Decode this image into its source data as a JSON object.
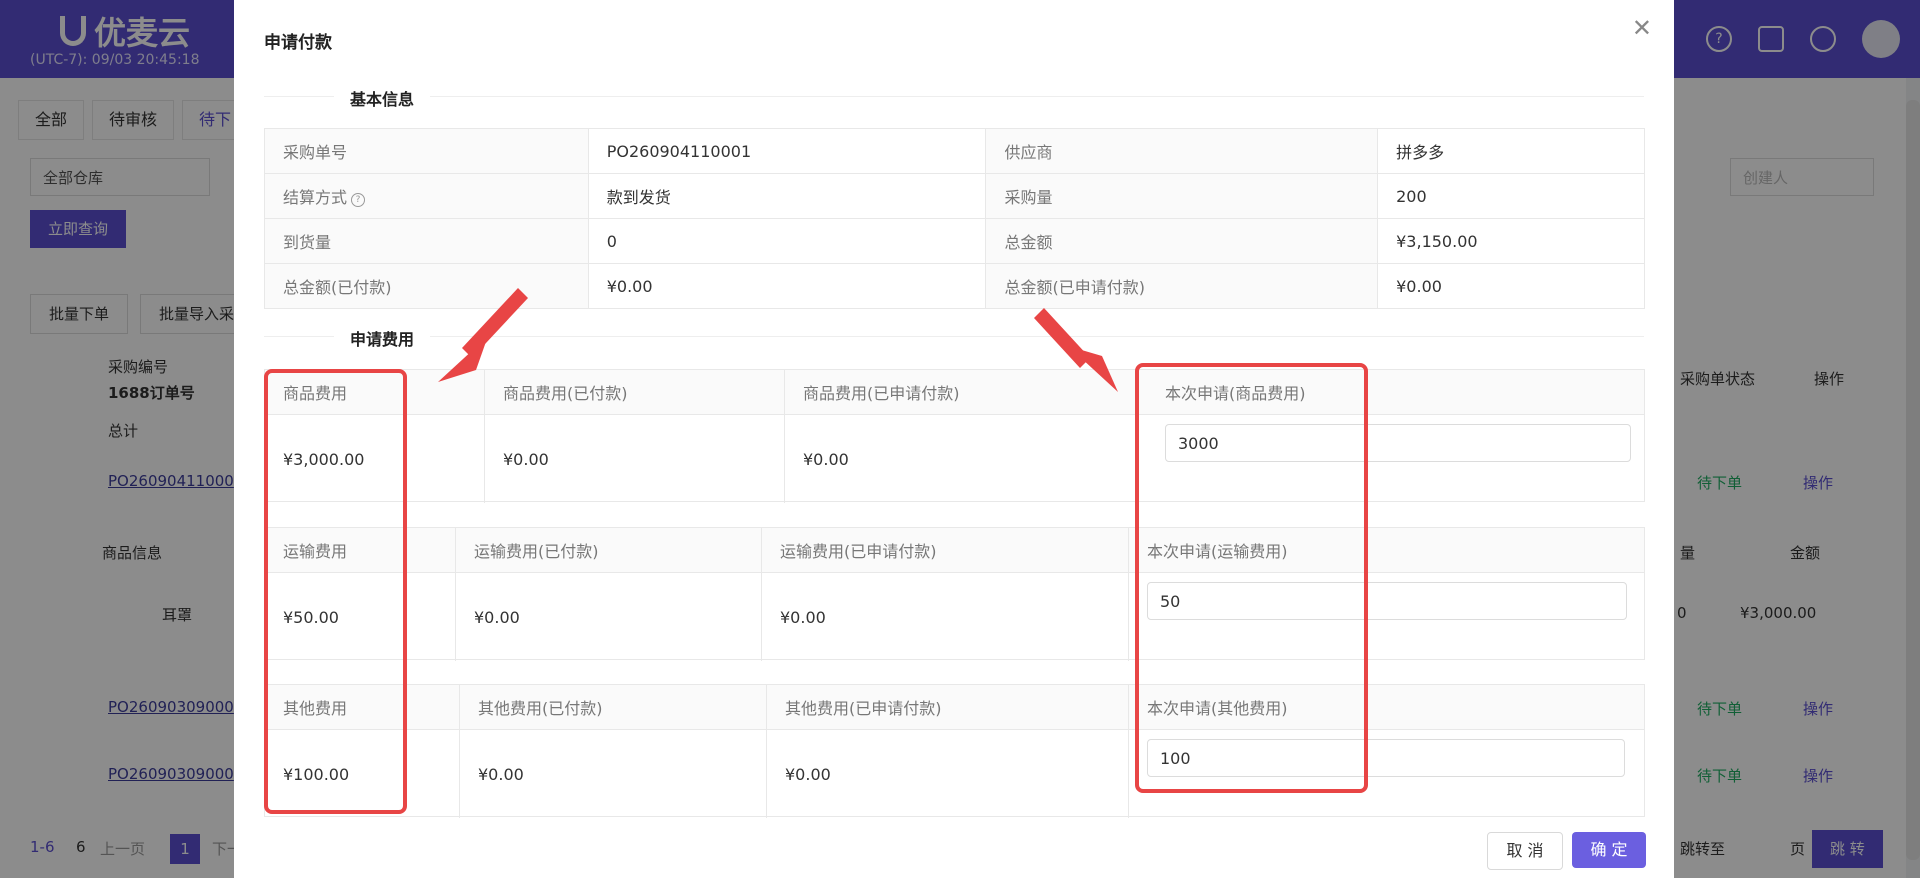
{
  "background_app": {
    "logo_text": "优麦云",
    "timezone": "(UTC-7): 09/03 20:45:18",
    "tabs": [
      "全部",
      "待审核",
      "待下"
    ],
    "warehouse_select": "全部仓库",
    "query_button": "立即查询",
    "creator_placeholder": "创建人",
    "batch_order_button": "批量下单",
    "batch_import_button": "批量导入采",
    "col_purchase_no": "采购编号",
    "col_1688_no": "1688订单号",
    "col_total": "总计",
    "col_status": "采购单状态",
    "col_action": "操作",
    "col_product_info": "商品信息",
    "col_qty": "量",
    "col_amount": "金额",
    "rows": [
      {
        "po": "PO26090411000",
        "status": "待下单",
        "action": "操作"
      },
      {
        "po": "PO26090309000",
        "status": "待下单",
        "action": "操作"
      },
      {
        "po": "PO26090309000",
        "status": "待下单",
        "action": "操作"
      }
    ],
    "product_name": "耳罩",
    "product_qty": "0",
    "product_amount": "¥3,000.00",
    "pagination": {
      "range": "1-6",
      "total": "6",
      "prev": "上一页",
      "current": "1",
      "next": "下一",
      "jump_to": "跳转至",
      "page_unit": "页",
      "jump_button": "跳 转"
    }
  },
  "modal": {
    "title": "申请付款",
    "close_icon": "close-icon",
    "basic_info": {
      "section_title": "基本信息",
      "rows": [
        {
          "l1": "采购单号",
          "v1": "PO260904110001",
          "l2": "供应商",
          "v2": "拼多多"
        },
        {
          "l1": "结算方式",
          "v1": "款到发货",
          "l2": "采购量",
          "v2": "200"
        },
        {
          "l1": "到货量",
          "v1": "0",
          "l2": "总金额",
          "v2": "¥3,150.00"
        },
        {
          "l1": "总金额(已付款)",
          "v1": "¥0.00",
          "l2": "总金额(已申请付款)",
          "v2": "¥0.00"
        }
      ]
    },
    "fees": {
      "section_title": "申请费用",
      "goods": {
        "h1": "商品费用",
        "h2": "商品费用(已付款)",
        "h3": "商品费用(已申请付款)",
        "h4": "本次申请(商品费用)",
        "v1": "¥3,000.00",
        "v2": "¥0.00",
        "v3": "¥0.00",
        "input": "3000"
      },
      "shipping": {
        "h1": "运输费用",
        "h2": "运输费用(已付款)",
        "h3": "运输费用(已申请付款)",
        "h4": "本次申请(运输费用)",
        "v1": "¥50.00",
        "v2": "¥0.00",
        "v3": "¥0.00",
        "input": "50"
      },
      "other": {
        "h1": "其他费用",
        "h2": "其他费用(已付款)",
        "h3": "其他费用(已申请付款)",
        "h4": "本次申请(其他费用)",
        "v1": "¥100.00",
        "v2": "¥0.00",
        "v3": "¥0.00",
        "input": "100"
      }
    },
    "cancel_label": "取 消",
    "ok_label": "确 定"
  },
  "annotation_color": "#e84545",
  "accent_color": "#5b4fd1"
}
